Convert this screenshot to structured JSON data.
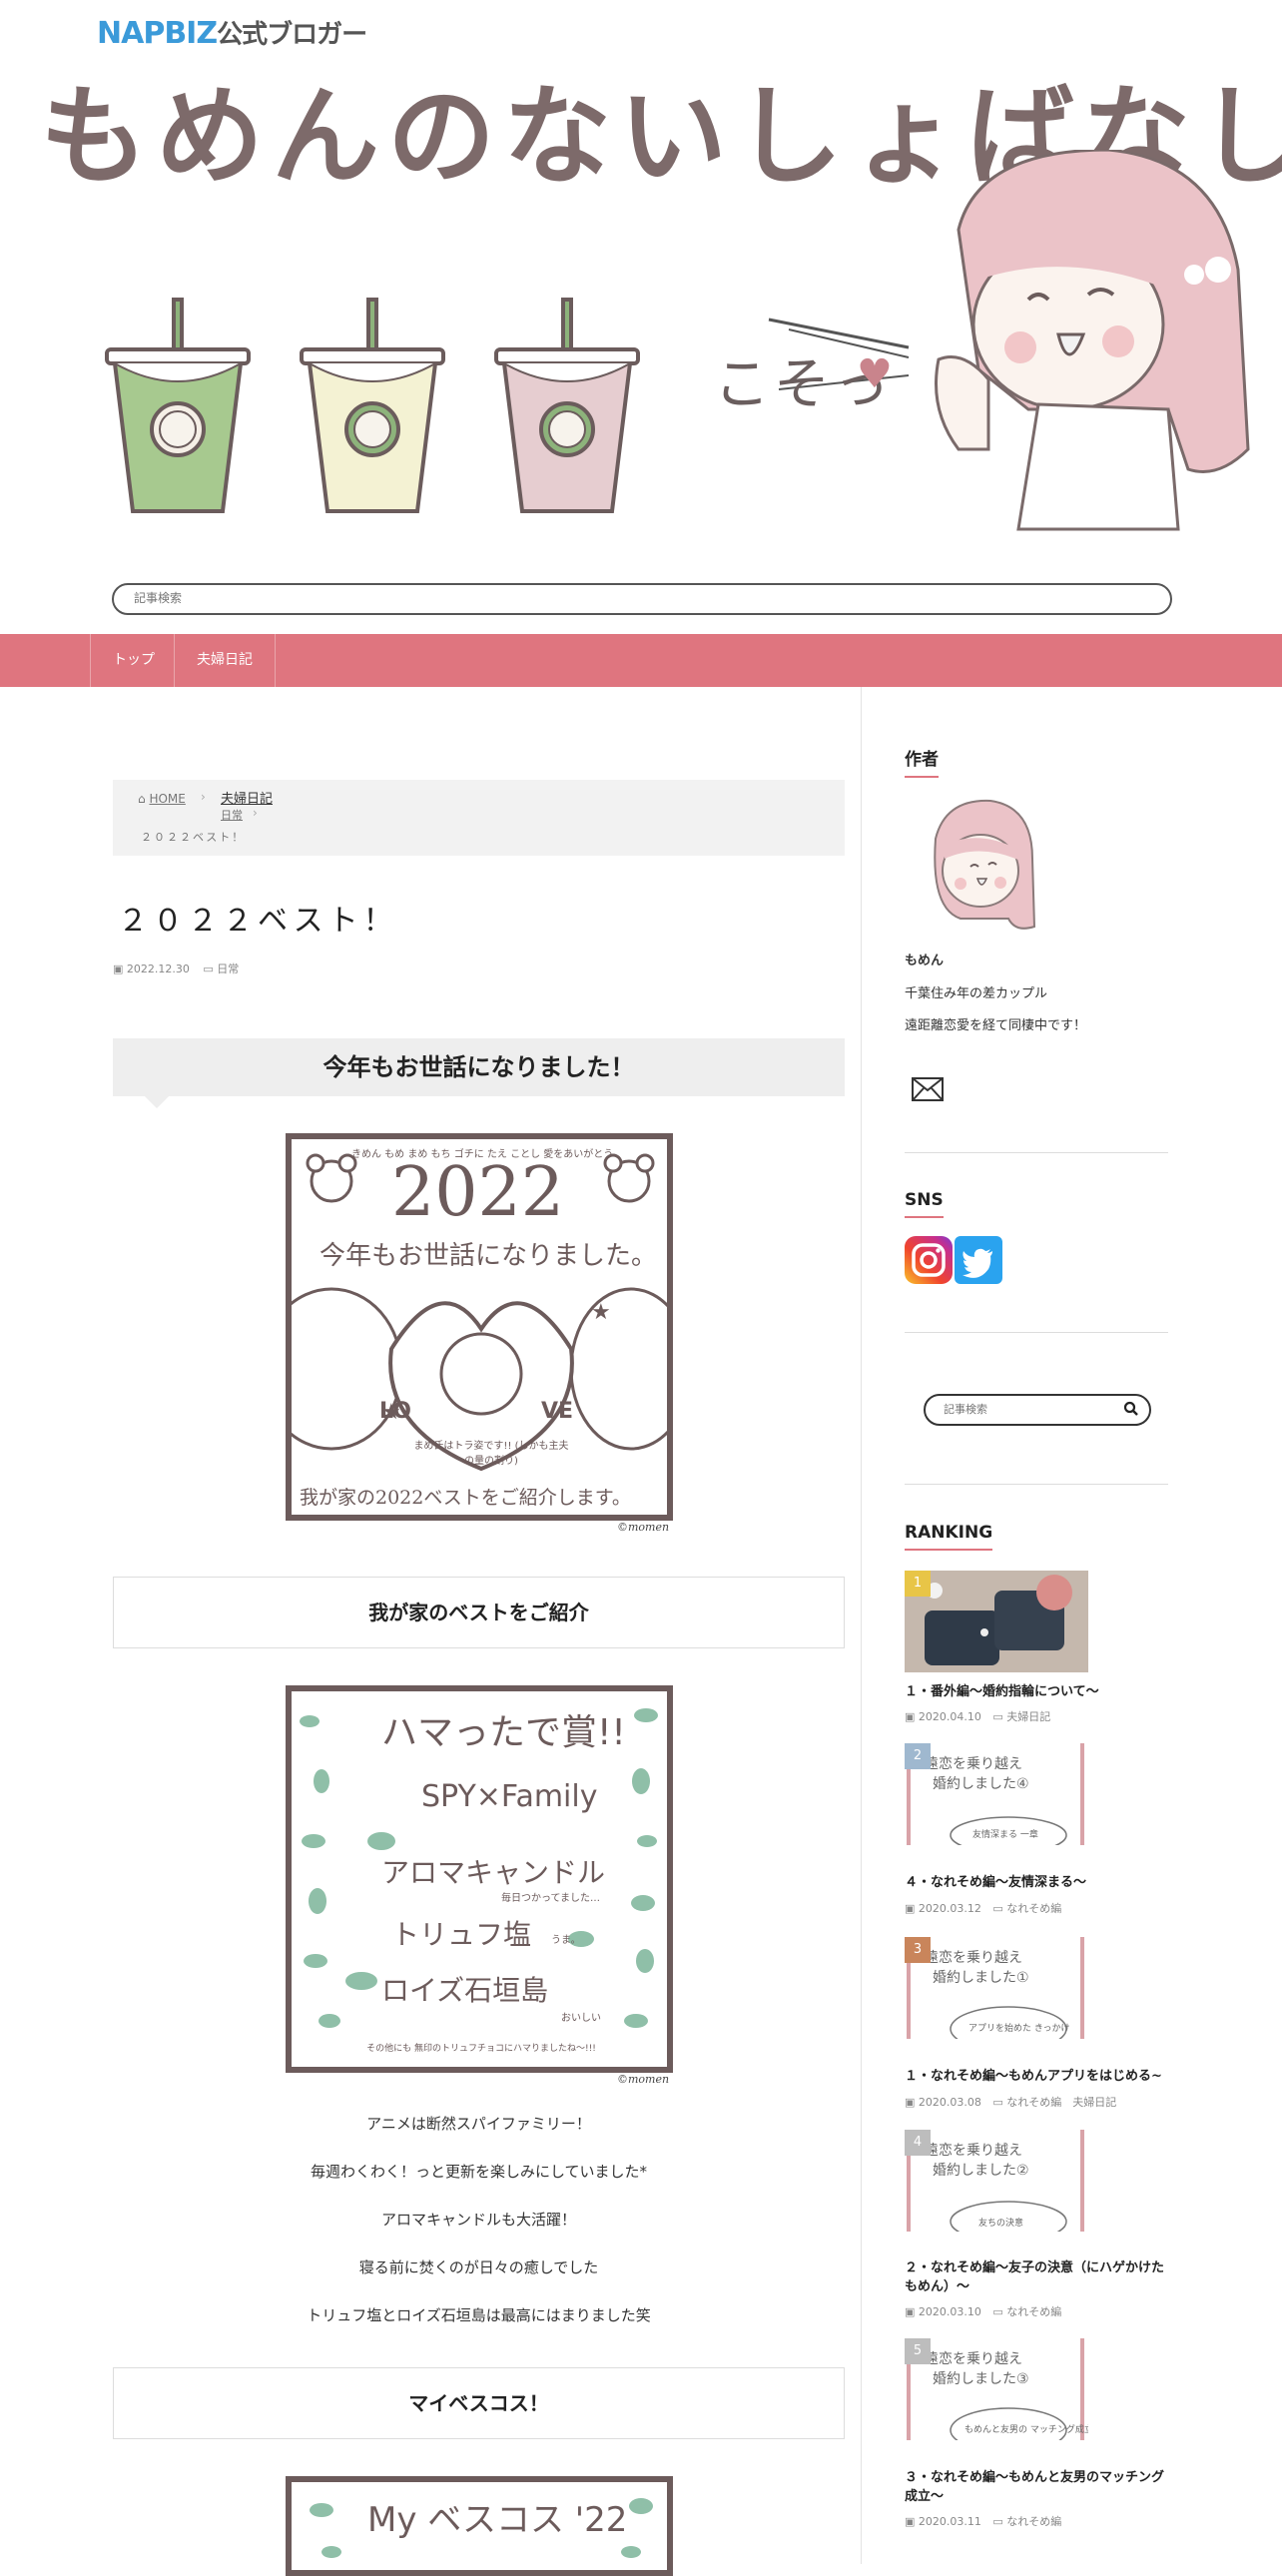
{
  "header": {
    "napbiz_brand": "NAPBIZ",
    "napbiz_sub": "公式ブロガー",
    "site_title": "もめんのないしょばなし",
    "kosotto": "こそっ",
    "search_placeholder": "記事検索"
  },
  "nav": {
    "items": [
      {
        "label": "トップ"
      },
      {
        "label": "夫婦日記"
      }
    ]
  },
  "breadcrumb": {
    "home": "HOME",
    "cat1": "夫婦日記",
    "cat2": "日常",
    "current": "２０２２ベスト！"
  },
  "post": {
    "title": "２０２２ベスト！",
    "date": "2022.12.30",
    "category": "日常",
    "heading1": "今年もお世話になりました！",
    "heading2": "我が家のベストをご紹介",
    "heading3": "マイベスコス！",
    "paragraphs": [
      "アニメは断然スパイファミリー！",
      "毎週わくわく！っと更新を楽しみにしていました*",
      "アロマキャンドルも大活躍！",
      "寝る前に焚くのが日々の癒しでした",
      "トリュフ塩とロイズ石垣島は最高にはまりました笑"
    ],
    "image1": {
      "top_note": "きめん もめ まめ もち ゴチに たえ ことし 愛をあいがとう",
      "year": "2022",
      "line": "今年もお世話になりました。",
      "love_l": "LO",
      "love_r": "VE",
      "sub_note": "まめ氏はトラ姿です!! (しかも主夫の量の割り)",
      "bottom": "我が家の2022ベストをご紹介します。",
      "credit": "©momen"
    },
    "image2": {
      "l1": "ハマったで賞!!",
      "l2": "SPY×Family",
      "l3": "アロマキャンドル",
      "l3_note": "毎日つかってました…",
      "l4": "トリュフ塩",
      "l4_note": "うま。",
      "l5": "ロイズ石垣島",
      "l5_note": "おいしい",
      "bottom": "その他にも 無印のトリュフチョコにハマりましたね～!!!",
      "credit": "©momen"
    },
    "image3": {
      "l1": "My ベスコス '22"
    }
  },
  "sidebar": {
    "author_title": "作者",
    "author_name": "もめん",
    "author_desc1": "千葉住み年の差カップル",
    "author_desc2": "遠距離恋愛を経て同棲中です！",
    "sns_title": "SNS",
    "search_placeholder": "記事検索",
    "ranking_title": "RANKING",
    "ranking": [
      {
        "rank": "1",
        "title": "１・番外編～婚約指輪について～",
        "date": "2020.04.10",
        "cats": "夫婦日記",
        "badge_color": "#e8c547",
        "img_l1": "",
        "img_l2": "",
        "img_note": ""
      },
      {
        "rank": "2",
        "title": "４・なれそめ編～友情深まる～",
        "date": "2020.03.12",
        "cats": "なれそめ編",
        "badge_color": "#9fb8cf",
        "img_l1": "遠恋を乗り越え",
        "img_l2": "婚約しました④",
        "img_note": "友情深まる 一章"
      },
      {
        "rank": "3",
        "title": "１・なれそめ編～もめんアプリをはじめる~",
        "date": "2020.03.08",
        "cats": "なれそめ編　夫婦日記",
        "badge_color": "#c9855b",
        "img_l1": "遠恋を乗り越え",
        "img_l2": "婚約しました①",
        "img_note": "アプリを始めた きっかけ"
      },
      {
        "rank": "4",
        "title": "２・なれそめ編～友子の決意（にハゲかけたもめん）～",
        "date": "2020.03.10",
        "cats": "なれそめ編",
        "badge_color": "#bdbdbd",
        "img_l1": "遠恋を乗り越え",
        "img_l2": "婚約しました②",
        "img_note": "友ちの決意"
      },
      {
        "rank": "5",
        "title": "３・なれそめ編～もめんと友男のマッチング成立～",
        "date": "2020.03.11",
        "cats": "なれそめ編",
        "badge_color": "#bdbdbd",
        "img_l1": "遠恋を乗り越え",
        "img_l2": "婚約しました③",
        "img_note": "もめんと友男の マッチング成立"
      }
    ]
  },
  "colors": {
    "nav": "#df757f",
    "accent": "#df757f",
    "card_border": "#6c5b5b"
  }
}
